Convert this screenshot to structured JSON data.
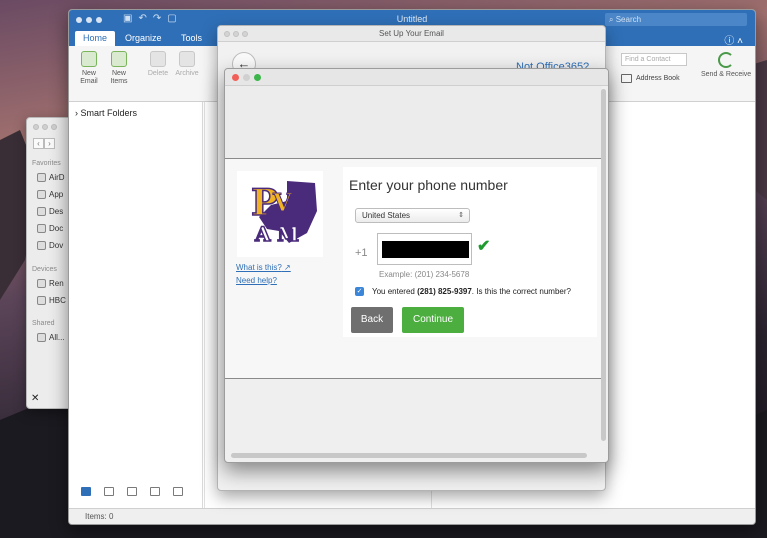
{
  "finder": {
    "favorites_header": "Favorites",
    "favorites": [
      "AirD",
      "App",
      "Des",
      "Doc",
      "Dov"
    ],
    "devices_header": "Devices",
    "devices": [
      "Ren",
      "HBC"
    ],
    "shared_header": "Shared",
    "shared": [
      "All..."
    ]
  },
  "outlook": {
    "window_title": "Untitled",
    "search_placeholder": "Search",
    "tabs": [
      "Home",
      "Organize",
      "Tools"
    ],
    "ribbon": {
      "new_email": "New Email",
      "new_items": "New Items",
      "delete": "Delete",
      "archive": "Archive",
      "find_contact_placeholder": "Find a Contact",
      "address_book": "Address Book",
      "send_receive": "Send & Receive"
    },
    "sidebar_folder": "Smart Folders",
    "status": "Items: 0",
    "accent_color": "#2f6fb7"
  },
  "setup": {
    "window_title": "Set Up Your Email",
    "not_office": "Not Office365?"
  },
  "modal": {
    "heading": "Enter your phone number",
    "country": "United States",
    "country_code": "+1",
    "example": "Example: (201) 234-5678",
    "confirm_prefix": "You entered ",
    "confirm_number": "(281) 825-9397",
    "confirm_suffix": ". Is this the correct number?",
    "what_is_this": "What is this?",
    "need_help": "Need help?",
    "back_label": "Back",
    "continue_label": "Continue",
    "logo_text": "PVAMU"
  }
}
